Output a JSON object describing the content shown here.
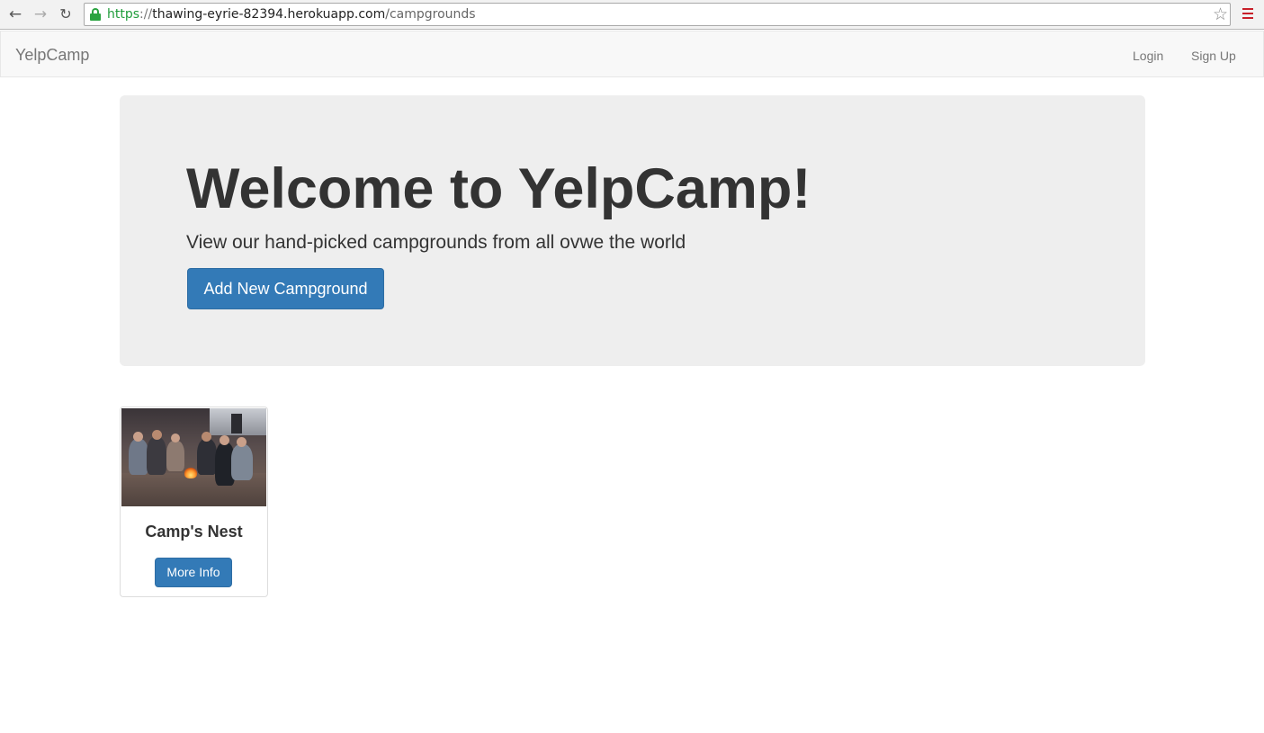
{
  "browser": {
    "url_scheme": "https",
    "url_sep": "://",
    "url_host": "thawing-eyrie-82394.herokuapp.com",
    "url_path": "/campgrounds",
    "icons": [
      "back-arrow-icon",
      "forward-arrow-icon",
      "reload-icon",
      "lock-icon",
      "star-icon",
      "menu-icon"
    ]
  },
  "navbar": {
    "brand": "YelpCamp",
    "login": "Login",
    "signup": "Sign Up"
  },
  "jumbotron": {
    "title": "Welcome to YelpCamp!",
    "subtitle": "View our hand-picked campgrounds from all ovwe the world",
    "add_button": "Add New Campground"
  },
  "campgrounds": [
    {
      "name": "Camp's Nest",
      "more_info": "More Info"
    }
  ],
  "colors": {
    "primary": "#337ab7",
    "jumbotron_bg": "#eeeeee",
    "navbar_bg": "#f8f8f8",
    "secure_green": "#1f9c3a"
  }
}
